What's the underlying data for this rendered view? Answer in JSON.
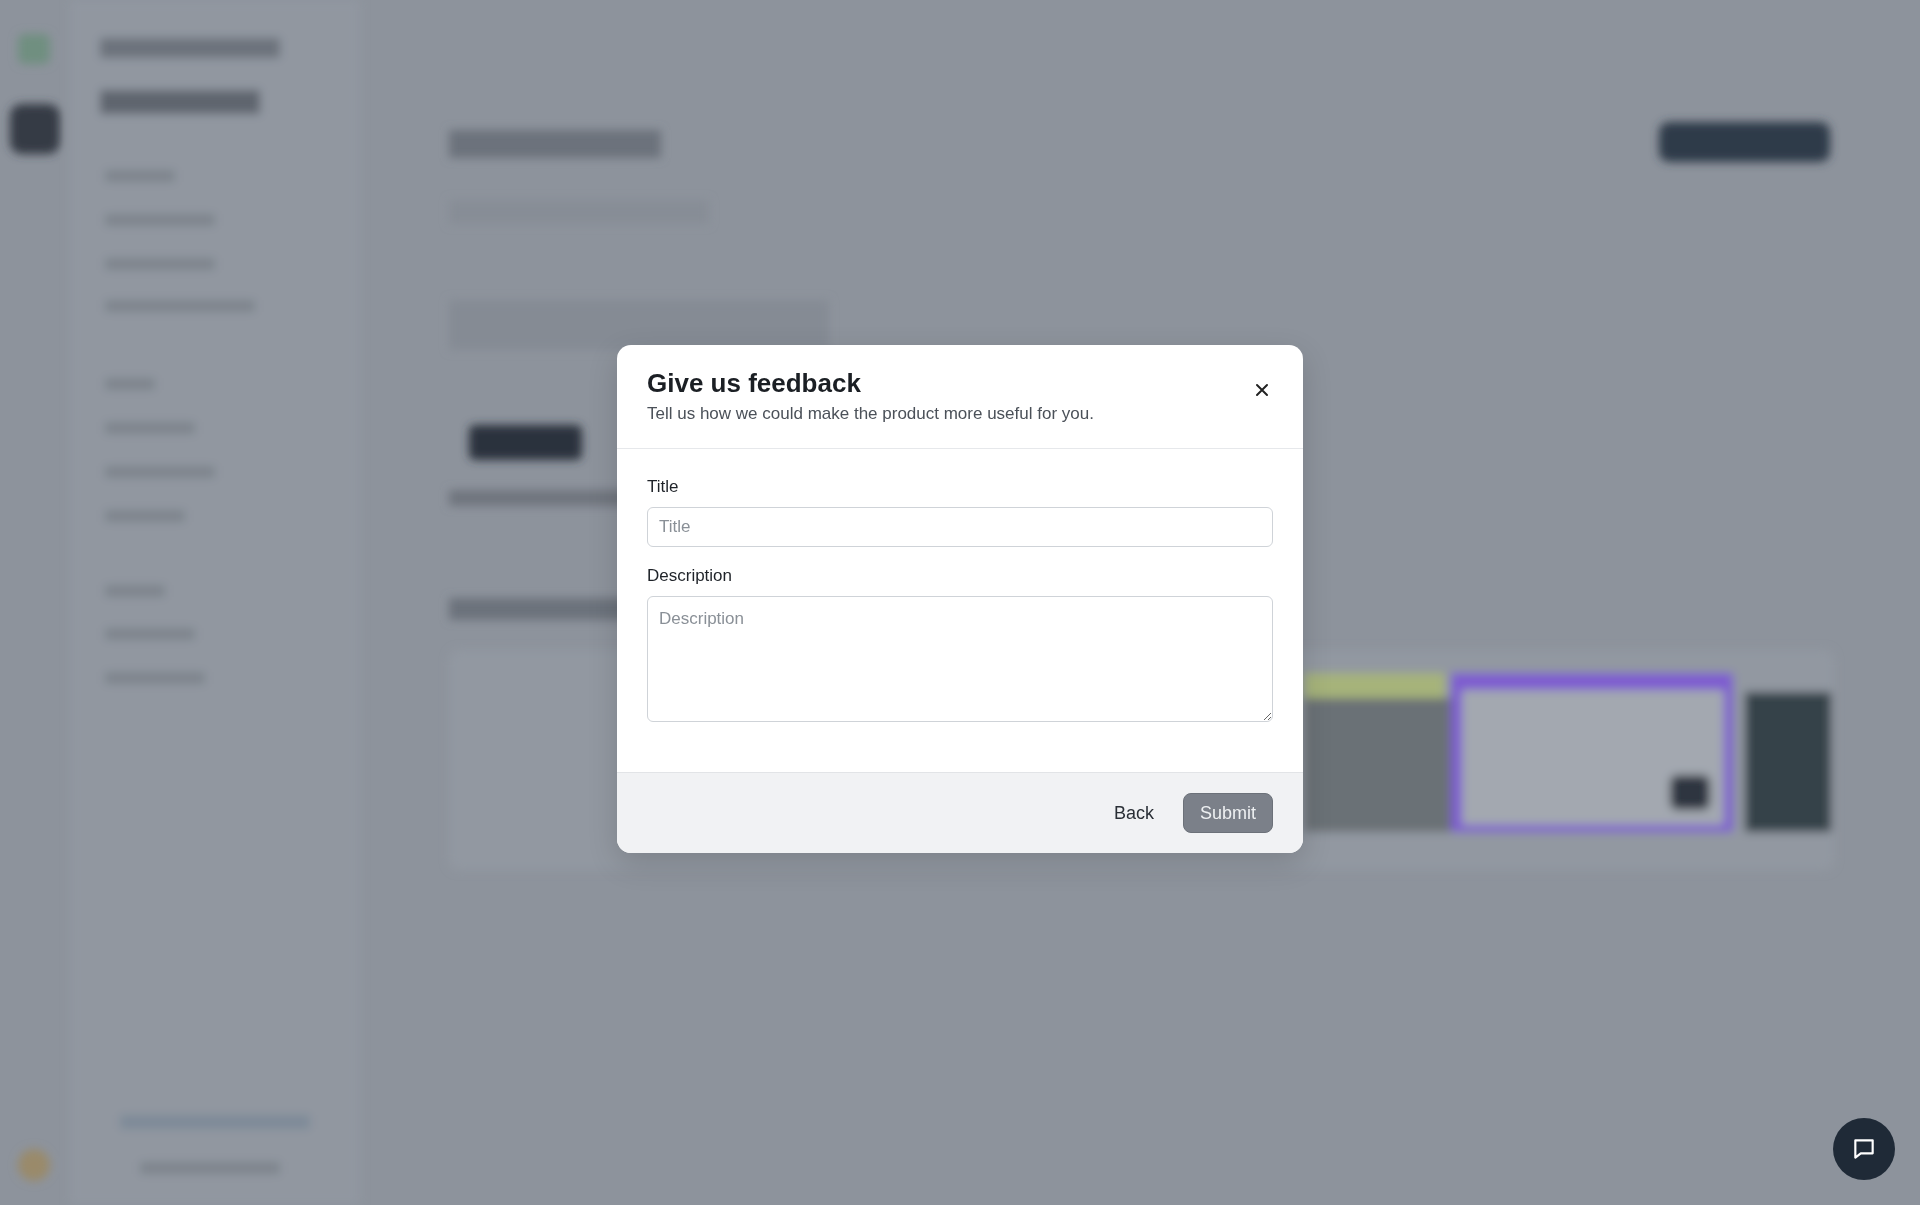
{
  "dialog": {
    "title": "Give us feedback",
    "subtitle": "Tell us how we could make the product more useful for you.",
    "fields": [
      {
        "kind": "input",
        "label": "Title",
        "placeholder": "Title"
      },
      {
        "kind": "textarea",
        "label": "Description",
        "placeholder": "Description"
      }
    ],
    "buttons": [
      {
        "kind": "secondary",
        "label": "Back",
        "disabled": false
      },
      {
        "kind": "primary",
        "label": "Submit",
        "disabled": true
      }
    ]
  }
}
